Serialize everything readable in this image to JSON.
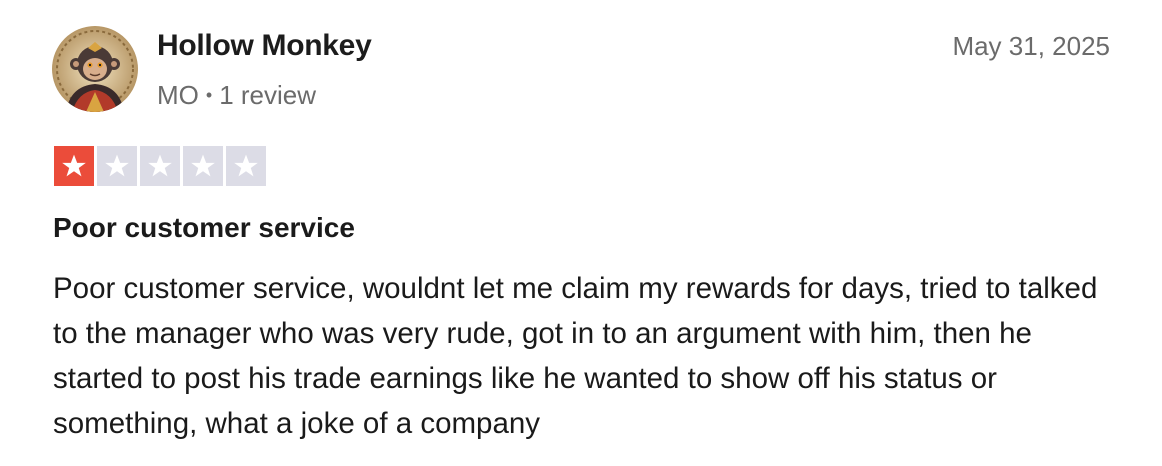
{
  "reviewer": {
    "name": "Hollow Monkey",
    "country": "MO",
    "separator": "•",
    "review_count": "1 review",
    "avatar_icon": "monkey-avatar-icon"
  },
  "review": {
    "date": "May 31, 2025",
    "rating": 1,
    "max_rating": 5,
    "title": "Poor customer service",
    "body": "Poor customer service, wouldnt let me claim my rewards for days, tried to talked to the manager who was very rude, got in to an argument with him, then he started to post his trade earnings like he wanted to show off his status or something, what a joke of a company"
  },
  "colors": {
    "star_filled": "#eb4c3a",
    "star_empty": "#dcdce6",
    "text_primary": "#1a1a1a",
    "text_secondary": "#6b6b6b"
  }
}
